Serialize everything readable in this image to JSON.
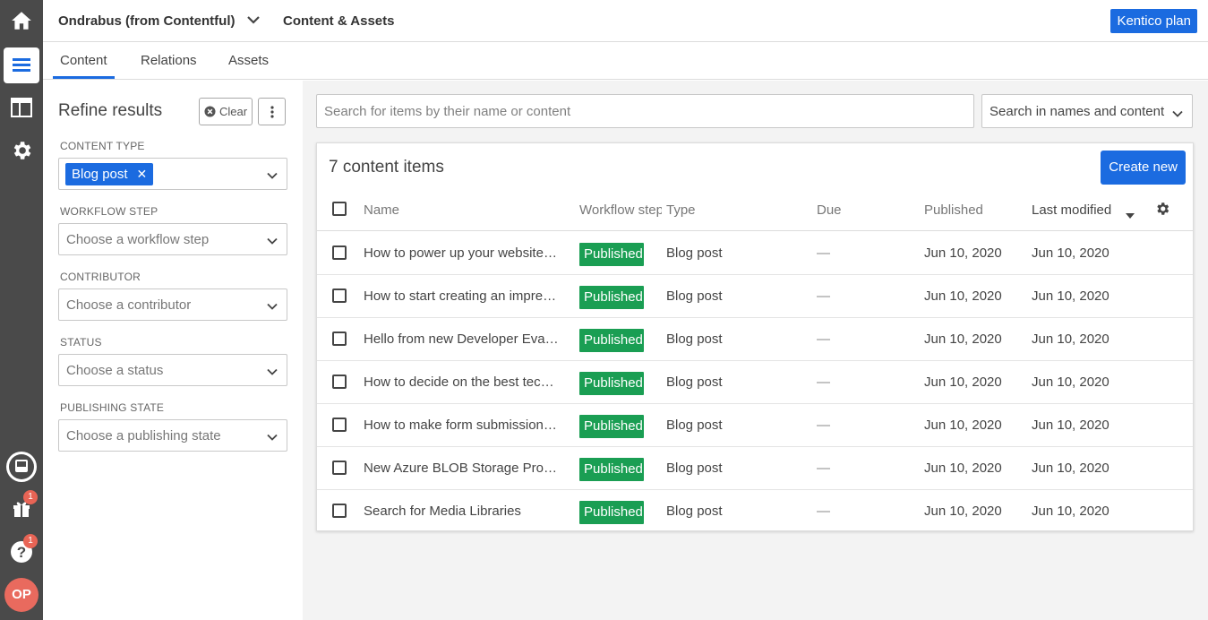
{
  "rail": {
    "items": [
      {
        "name": "home-icon"
      },
      {
        "name": "content-list-icon",
        "active": true
      },
      {
        "name": "layout-icon"
      },
      {
        "name": "settings-gear-icon"
      }
    ],
    "bottom": [
      {
        "name": "inbox-icon"
      },
      {
        "name": "gift-icon",
        "badge": "1"
      },
      {
        "name": "help-icon",
        "badge": "1"
      }
    ],
    "avatar_initials": "OP"
  },
  "header": {
    "project": "Ondrabus (from Contentful)",
    "section": "Content & Assets",
    "plan_button": "Kentico plan"
  },
  "tabs": [
    "Content",
    "Relations",
    "Assets"
  ],
  "filters": {
    "title": "Refine results",
    "clear_label": "Clear",
    "content_type": {
      "label": "CONTENT TYPE",
      "chip": "Blog post"
    },
    "workflow_step": {
      "label": "WORKFLOW STEP",
      "placeholder": "Choose a workflow step"
    },
    "contributor": {
      "label": "CONTRIBUTOR",
      "placeholder": "Choose a contributor"
    },
    "status": {
      "label": "STATUS",
      "placeholder": "Choose a status"
    },
    "publishing_state": {
      "label": "PUBLISHING STATE",
      "placeholder": "Choose a publishing state"
    }
  },
  "search": {
    "placeholder": "Search for items by their name or content",
    "scope": "Search in names and content"
  },
  "list": {
    "count_label": "7 content items",
    "create_button": "Create new",
    "columns": {
      "name": "Name",
      "workflow": "Workflow step",
      "type": "Type",
      "due": "Due",
      "published": "Published",
      "last_modified": "Last modified"
    },
    "rows": [
      {
        "name": "How to power up your website with ready-made content",
        "workflow": "Published",
        "type": "Blog post",
        "due": "—",
        "published": "Jun 10, 2020",
        "modified": "Jun 10, 2020"
      },
      {
        "name": "How to start creating an impressive website",
        "workflow": "Published",
        "type": "Blog post",
        "due": "—",
        "published": "Jun 10, 2020",
        "modified": "Jun 10, 2020"
      },
      {
        "name": "Hello from new Developer Evangelist",
        "workflow": "Published",
        "type": "Blog post",
        "due": "—",
        "published": "Jun 10, 2020",
        "modified": "Jun 10, 2020"
      },
      {
        "name": "How to decide on the best technology",
        "workflow": "Published",
        "type": "Blog post",
        "due": "—",
        "published": "Jun 10, 2020",
        "modified": "Jun 10, 2020"
      },
      {
        "name": "How to make form submissions work",
        "workflow": "Published",
        "type": "Blog post",
        "due": "—",
        "published": "Jun 10, 2020",
        "modified": "Jun 10, 2020"
      },
      {
        "name": "New Azure BLOB Storage Provider",
        "workflow": "Published",
        "type": "Blog post",
        "due": "—",
        "published": "Jun 10, 2020",
        "modified": "Jun 10, 2020"
      },
      {
        "name": "Search for Media Libraries",
        "workflow": "Published",
        "type": "Blog post",
        "due": "—",
        "published": "Jun 10, 2020",
        "modified": "Jun 10, 2020"
      }
    ]
  },
  "colors": {
    "accent": "#1b6be0",
    "published": "#1a9e53",
    "rail": "#4a4a4a",
    "avatar": "#e96a5e"
  }
}
